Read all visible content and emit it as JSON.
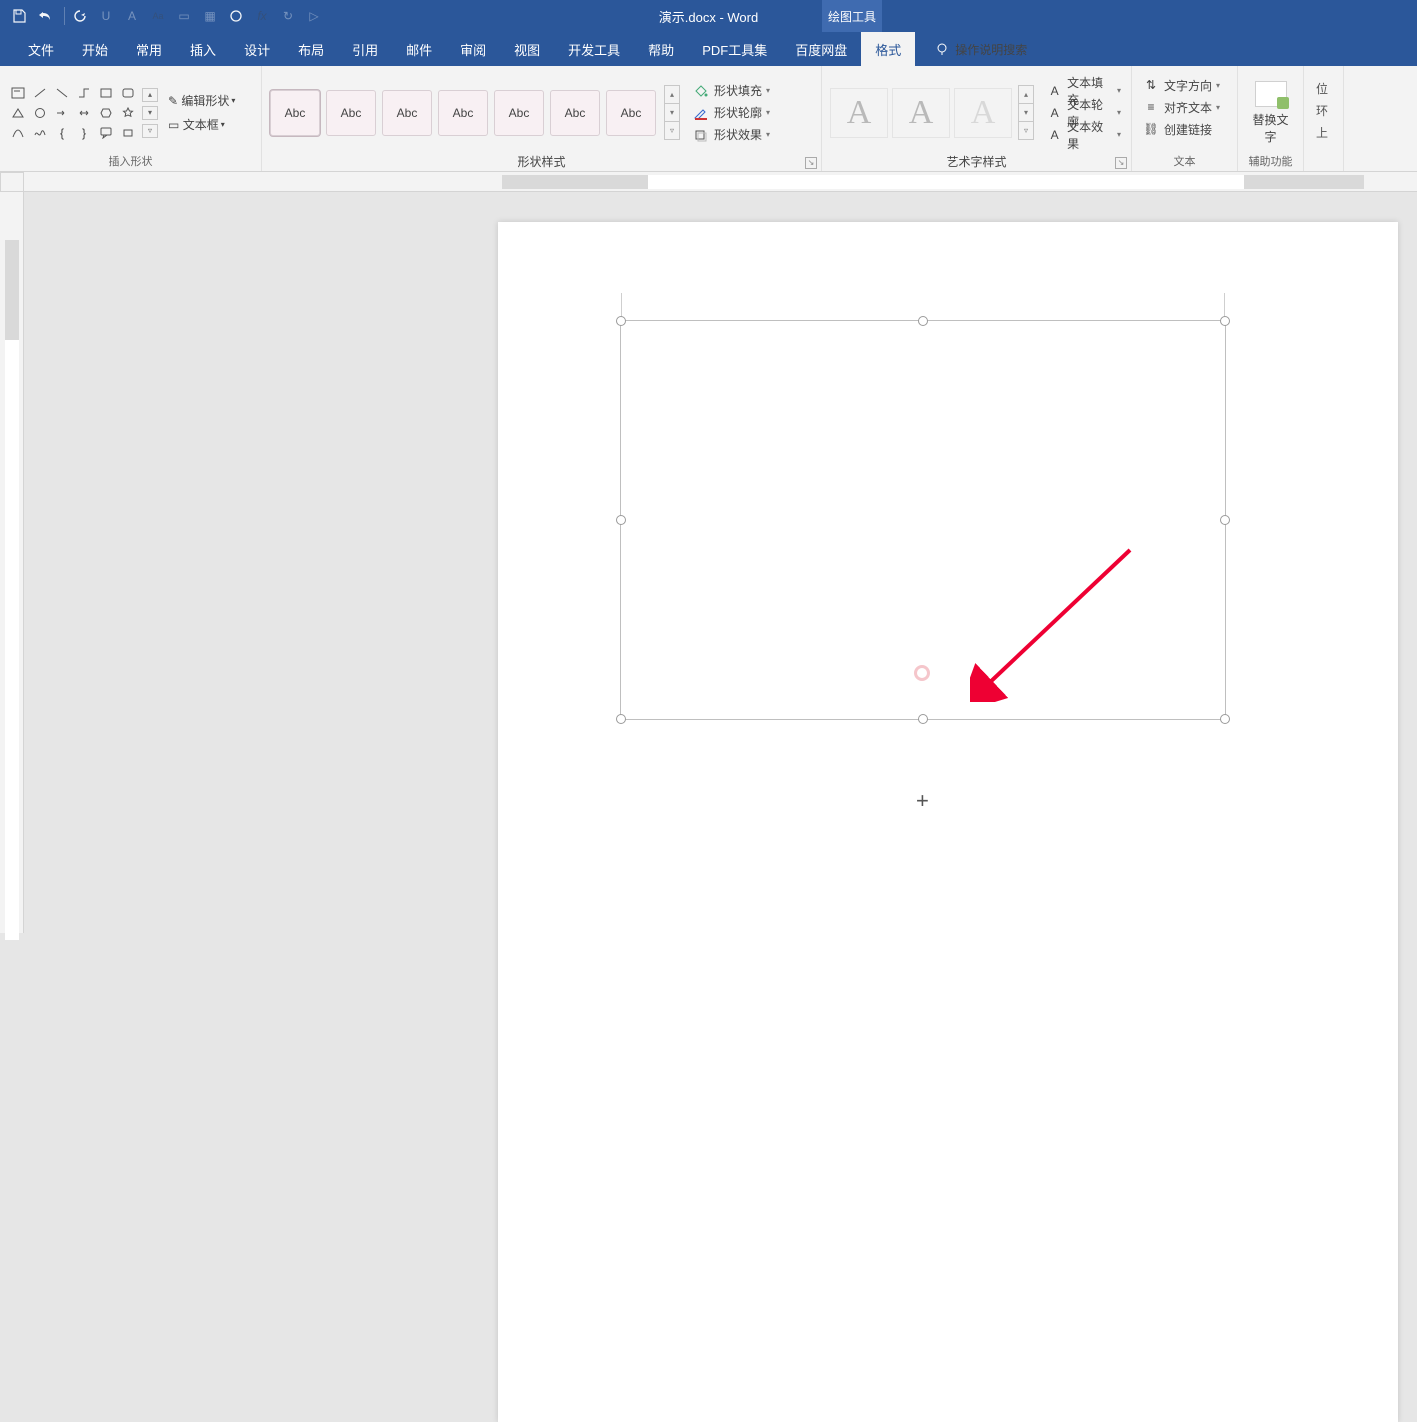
{
  "app": {
    "title": "演示.docx - Word",
    "context_tab": "绘图工具"
  },
  "qat": {
    "items": [
      {
        "name": "save-icon",
        "dim": false
      },
      {
        "name": "undo-icon",
        "dim": false
      },
      {
        "name": "redo-icon",
        "dim": false
      },
      {
        "name": "underline-icon",
        "dim": true
      },
      {
        "name": "font-icon",
        "dim": true
      },
      {
        "name": "font-size-icon",
        "dim": true
      },
      {
        "name": "highlight-icon",
        "dim": true
      },
      {
        "name": "table-icon",
        "dim": true
      },
      {
        "name": "circle-icon",
        "dim": false
      },
      {
        "name": "formula-icon",
        "dim": true
      },
      {
        "name": "refresh-icon",
        "dim": true
      },
      {
        "name": "play-icon",
        "dim": true
      }
    ]
  },
  "tabs": {
    "items": [
      "文件",
      "开始",
      "常用",
      "插入",
      "设计",
      "布局",
      "引用",
      "邮件",
      "审阅",
      "视图",
      "开发工具",
      "帮助",
      "PDF工具集",
      "百度网盘"
    ],
    "format": "格式",
    "tell_me": "操作说明搜索"
  },
  "ribbon": {
    "insert_shapes": {
      "label": "插入形状",
      "edit_shape": "编辑形状",
      "text_box": "文本框"
    },
    "shape_styles": {
      "label": "形状样式",
      "sample": "Abc",
      "fill": "形状填充",
      "outline": "形状轮廓",
      "effects": "形状效果"
    },
    "wordart": {
      "label": "艺术字样式",
      "sample": "A",
      "fill": "文本填充",
      "outline": "文本轮廓",
      "effects": "文本效果"
    },
    "text": {
      "label": "文本",
      "direction": "文字方向",
      "align": "对齐文本",
      "link": "创建链接"
    },
    "assist": {
      "label": "辅助功能",
      "alt_text": "替换文字"
    },
    "trunc": {
      "r1": "位",
      "r2": "环",
      "r3": "上"
    }
  }
}
